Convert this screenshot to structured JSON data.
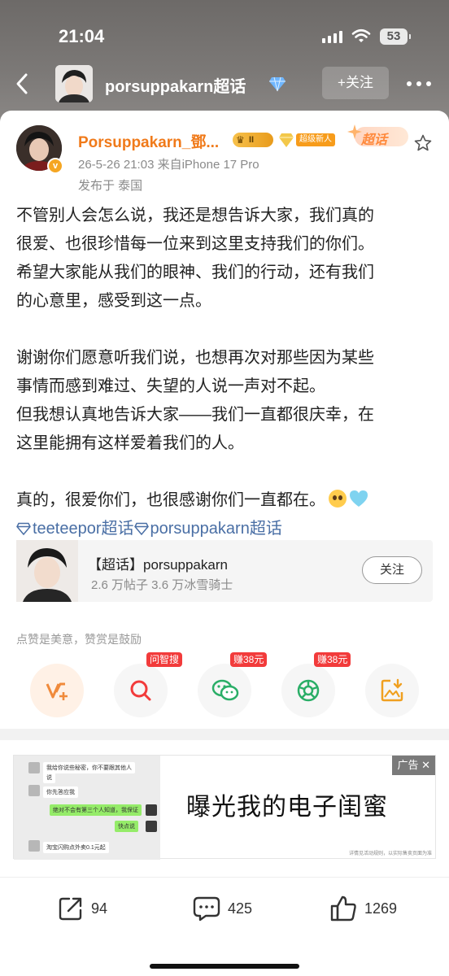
{
  "status": {
    "time": "21:04",
    "battery": "53"
  },
  "nav": {
    "title": "porsuppakarn超话",
    "follow": "+关注"
  },
  "post": {
    "username": "Porsuppakarn_鄧...",
    "level_badge": "II",
    "new_badge": "超级新人",
    "chaohua_badge": "超话",
    "meta": "26-5-26 21:03  来自iPhone 17 Pro",
    "location": "发布于 泰国",
    "lines": [
      "不管别人会怎么说，我还是想告诉大家，我们真的",
      "很爱、也很珍惜每一位来到这里支持我们的你们。",
      "希望大家能从我们的眼神、我们的行动，还有我们",
      "的心意里，感受到这一点。",
      "",
      "谢谢你们愿意听我们说，也想再次对那些因为某些",
      "事情而感到难过、失望的人说一声对不起。",
      "但我想认真地告诉大家——我们一直都很庆幸，在",
      "这里能拥有这样爱着我们的人。",
      ""
    ],
    "last_line": "真的，很爱你们，也很感谢你们一直都在。",
    "topic1": "teeteepor超话",
    "topic2": "porsuppakarn超话"
  },
  "topic_card": {
    "title": "【超话】porsuppakarn",
    "stats": "2.6 万帖子  3.6 万冰雪骑士",
    "follow": "关注"
  },
  "tip": "点赞是美意，赞赏是鼓励",
  "actions": {
    "tag_search": "问智搜",
    "tag_wechat": "赚38元",
    "tag_moments": "赚38元"
  },
  "ad": {
    "label": "广告 ✕",
    "headline": "曝光我的电子闺蜜",
    "chat": [
      "我给你说些秘密，你不要跟其他人",
      "说",
      "你先答应我",
      "绝对不会有第三个人知道，我保证",
      "快点说",
      "淘宝闪购点外卖0.1元起"
    ],
    "footnote": "详情见活动规则，以实际售卖页面为准"
  },
  "bottom": {
    "share": "94",
    "comment": "425",
    "like": "1269"
  },
  "colors": {
    "orange": "#f07a1a",
    "topic_blue": "#4a6fa5",
    "tag_red": "#f23b3b"
  }
}
